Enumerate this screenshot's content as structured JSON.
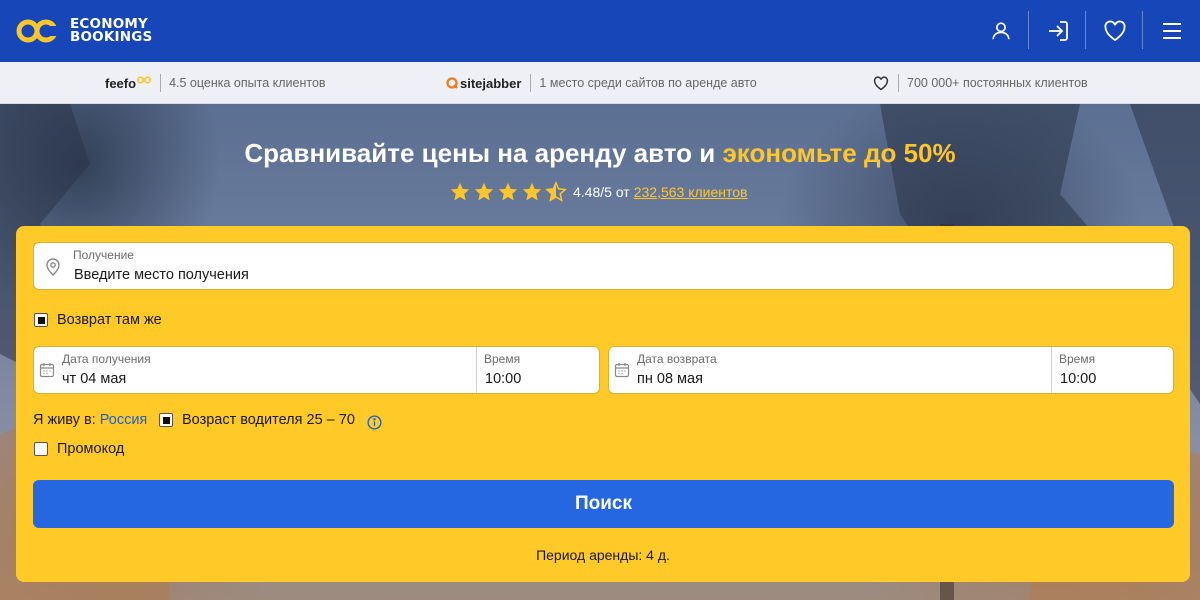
{
  "header": {
    "logo_line1": "ECONOMY",
    "logo_line2": "BOOKINGS",
    "icons": [
      "user-icon",
      "sign-in-icon",
      "heart-icon",
      "menu-icon"
    ]
  },
  "trust": {
    "feefo_brand": "feefo",
    "feefo_text": "4.5 оценка опыта клиентов",
    "sitejabber_brand": "sitejabber",
    "sitejabber_text": "1 место среди сайтов по аренде авто",
    "loyal_text": "700 000+ постоянных клиентов"
  },
  "hero": {
    "title_main": "Сравнивайте цены на аренду авто и ",
    "title_accent": "экономьте до 50%",
    "rating_value": "4.48/5 от",
    "rating_link": "232,563 клиентов",
    "stars": 4.5
  },
  "form": {
    "pickup_label": "Получение",
    "pickup_placeholder": "Введите место получения",
    "same_return_label": "Возврат там же",
    "same_return_checked": true,
    "pickup_date_label": "Дата получения",
    "pickup_date_value": "чт 04 мая",
    "pickup_time_label": "Время",
    "pickup_time_value": "10:00",
    "return_date_label": "Дата возврата",
    "return_date_value": "пн 08 мая",
    "return_time_label": "Время",
    "return_time_value": "10:00",
    "live_label": "Я живу в:",
    "country": "Россия",
    "driver_age_label": "Возраст водителя 25 – 70",
    "driver_age_checked": true,
    "promo_label": "Промокод",
    "promo_checked": false,
    "search_label": "Поиск",
    "period_text": "Период аренды: 4 д."
  },
  "colors": {
    "header_bg": "#1646b8",
    "accent_yellow": "#ffc629",
    "card_bg": "#ffca28",
    "button_blue": "#2467e0"
  }
}
